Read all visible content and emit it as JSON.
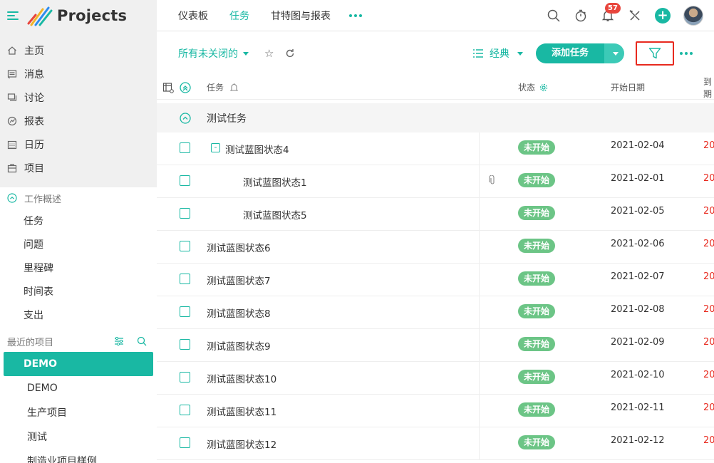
{
  "app": {
    "title": "Projects"
  },
  "nav": [
    {
      "label": "主页",
      "icon": "home-icon"
    },
    {
      "label": "消息",
      "icon": "message-icon"
    },
    {
      "label": "讨论",
      "icon": "discussion-icon"
    },
    {
      "label": "报表",
      "icon": "report-icon"
    },
    {
      "label": "日历",
      "icon": "calendar-icon"
    },
    {
      "label": "项目",
      "icon": "project-icon"
    }
  ],
  "work_overview": {
    "title": "工作概述",
    "items": [
      "任务",
      "问题",
      "里程碑",
      "时间表",
      "支出"
    ]
  },
  "recent_projects": {
    "title": "最近的项目",
    "items": [
      "DEMO",
      "DEMO",
      "生产项目",
      "测试",
      "制造业项目样例"
    ]
  },
  "topbar": {
    "tabs": [
      "仪表板",
      "任务",
      "甘特图与报表"
    ],
    "active_tab": "任务",
    "notifications_count": "57"
  },
  "toolbar": {
    "view_label": "所有未关闭的",
    "layout_label": "经典",
    "add_task_label": "添加任务"
  },
  "table": {
    "headers": {
      "task": "任务",
      "status": "状态",
      "start": "开始日期",
      "end": "到期"
    },
    "group": "测试任务",
    "rows": [
      {
        "name": "测试蓝图状态4",
        "status": "未开始",
        "start": "2021-02-04",
        "end": "20",
        "level": 0,
        "expandable": true
      },
      {
        "name": "测试蓝图状态1",
        "status": "未开始",
        "start": "2021-02-01",
        "end": "20",
        "level": 1,
        "attachment": true
      },
      {
        "name": "测试蓝图状态5",
        "status": "未开始",
        "start": "2021-02-05",
        "end": "20",
        "level": 1
      },
      {
        "name": "测试蓝图状态6",
        "status": "未开始",
        "start": "2021-02-06",
        "end": "20",
        "level": 0
      },
      {
        "name": "测试蓝图状态7",
        "status": "未开始",
        "start": "2021-02-07",
        "end": "20",
        "level": 0
      },
      {
        "name": "测试蓝图状态8",
        "status": "未开始",
        "start": "2021-02-08",
        "end": "20",
        "level": 0
      },
      {
        "name": "测试蓝图状态9",
        "status": "未开始",
        "start": "2021-02-09",
        "end": "20",
        "level": 0
      },
      {
        "name": "测试蓝图状态10",
        "status": "未开始",
        "start": "2021-02-10",
        "end": "20",
        "level": 0
      },
      {
        "name": "测试蓝图状态11",
        "status": "未开始",
        "start": "2021-02-11",
        "end": "20",
        "level": 0
      },
      {
        "name": "测试蓝图状态12",
        "status": "未开始",
        "start": "2021-02-12",
        "end": "20",
        "level": 0
      }
    ]
  },
  "colors": {
    "accent": "#19b8a3",
    "status_not_started": "#6cc586",
    "overdue": "#e82a1f",
    "highlight": "#e82a1f"
  }
}
